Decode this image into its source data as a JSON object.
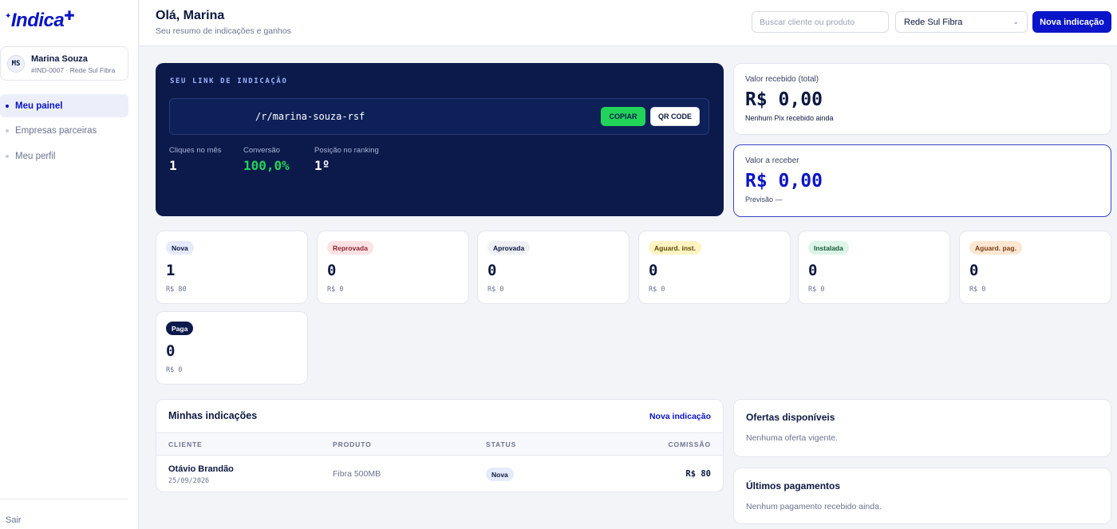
{
  "brand": {
    "logo": "Indica"
  },
  "user": {
    "initials": "MS",
    "name": "Marina Souza",
    "meta": "#IND-0007 · Rede Sul Fibra"
  },
  "sidebar": {
    "items": [
      {
        "label": "Meu painel",
        "active": true
      },
      {
        "label": "Empresas parceiras",
        "active": false
      },
      {
        "label": "Meu perfil",
        "active": false
      }
    ],
    "logout": "Sair"
  },
  "header": {
    "greeting": "Olá, Marina",
    "subtitle": "Seu resumo de indicações e ganhos",
    "search_placeholder": "Buscar cliente ou produto",
    "company_select": "Rede Sul Fibra",
    "new_referral_button": "Nova indicação"
  },
  "link_card": {
    "title": "SEU LINK DE INDICAÇÃO",
    "url": "/r/marina-souza-rsf",
    "copy_button": "COPIAR",
    "qr_button": "QR CODE",
    "stats": [
      {
        "label": "Cliques no mês",
        "value": "1"
      },
      {
        "label": "Conversão",
        "value": "100,0%"
      },
      {
        "label": "Posição no ranking",
        "value": "1º"
      }
    ]
  },
  "received": {
    "label": "Valor recebido (total)",
    "value": "R$ 0,00",
    "note": "Nenhum Pix recebido ainda"
  },
  "to_receive": {
    "label": "Valor a receber",
    "value": "R$ 0,00",
    "note": "Previsão —"
  },
  "status_cards": [
    {
      "badge": "Nova",
      "count": "1",
      "amount": "R$ 80"
    },
    {
      "badge": "Reprovada",
      "count": "0",
      "amount": "R$ 0"
    },
    {
      "badge": "Aprovada",
      "count": "0",
      "amount": "R$ 0"
    },
    {
      "badge": "Aguard. inst.",
      "count": "0",
      "amount": "R$ 0"
    },
    {
      "badge": "Instalada",
      "count": "0",
      "amount": "R$ 0"
    },
    {
      "badge": "Aguard. pag.",
      "count": "0",
      "amount": "R$ 0"
    },
    {
      "badge": "Paga",
      "count": "0",
      "amount": "R$ 0"
    }
  ],
  "colors": {
    "accent": "#0a14c8",
    "navy": "#0b1a4a",
    "green": "#22d35a",
    "badge_nova": "#e6ebfb",
    "badge_reprovada": "#fde2e4",
    "badge_aprovada": "#eef0f4",
    "badge_aguard_inst": "#fff4c2",
    "badge_instalada": "#dcf5e8",
    "badge_aguard_pag": "#fde6d2",
    "badge_paga": "#0b1a4a"
  },
  "referrals": {
    "title": "Minhas indicações",
    "link": "Nova indicação",
    "columns": [
      "CLIENTE",
      "PRODUTO",
      "STATUS",
      "COMISSÃO"
    ],
    "rows": [
      {
        "client": "Otávio Brandão",
        "date": "25/09/2026",
        "product": "Fibra 500MB",
        "status": "Nova",
        "commission": "R$ 80"
      }
    ]
  },
  "offers": {
    "title": "Ofertas disponíveis",
    "empty": "Nenhuma oferta vigente."
  },
  "payments": {
    "title": "Últimos pagamentos",
    "empty": "Nenhum pagamento recebido ainda."
  }
}
